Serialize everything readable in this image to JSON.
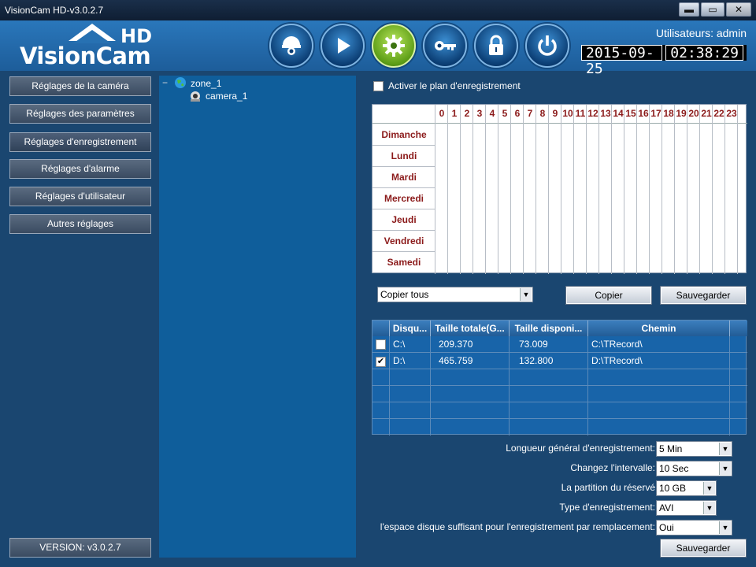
{
  "window": {
    "title": "VisionCam HD-v3.0.2.7",
    "min": "▬",
    "max": "▭",
    "close": "✕"
  },
  "logo": {
    "hd": "HD",
    "name": "VisionCam"
  },
  "toolbar": [
    {
      "icon": "camera-dome-icon"
    },
    {
      "icon": "play-icon"
    },
    {
      "icon": "gear-icon",
      "active": true
    },
    {
      "icon": "key-icon"
    },
    {
      "icon": "lock-icon"
    },
    {
      "icon": "power-icon"
    }
  ],
  "header": {
    "users": "Utilisateurs: admin",
    "date": "2015-09-25",
    "time": "02:38:29"
  },
  "sidebar": {
    "items": [
      {
        "label": "Réglages de la caméra"
      },
      {
        "label": "Réglages des paramètres"
      },
      {
        "label": "Réglages d'enregistrement",
        "active": true
      },
      {
        "label": "Réglages d'alarme"
      },
      {
        "label": "Réglages d'utilisateur"
      },
      {
        "label": "Autres réglages"
      }
    ],
    "version": "VERSION: v3.0.2.7"
  },
  "tree": {
    "toggle": "−",
    "zone": "zone_1",
    "camera": "camera_1"
  },
  "schedule": {
    "enable_label": "Activer le plan d'enregistrement",
    "enabled": false,
    "hours": [
      "0",
      "1",
      "2",
      "3",
      "4",
      "5",
      "6",
      "7",
      "8",
      "9",
      "10",
      "11",
      "12",
      "13",
      "14",
      "15",
      "16",
      "17",
      "18",
      "19",
      "20",
      "21",
      "22",
      "23"
    ],
    "days": [
      "Dimanche",
      "Lundi",
      "Mardi",
      "Mercredi",
      "Jeudi",
      "Vendredi",
      "Samedi"
    ]
  },
  "copy": {
    "select_value": "Copier tous",
    "copy_label": "Copier",
    "save_label": "Sauvegarder"
  },
  "disks": {
    "columns": [
      "Disqu...",
      "Taille totale(G...",
      "Taille disponi...",
      "Chemin"
    ],
    "rows": [
      {
        "checked": false,
        "disk": "C:\\",
        "total": "209.370",
        "avail": "73.009",
        "path": "C:\\TRecord\\"
      },
      {
        "checked": true,
        "disk": "D:\\",
        "total": "465.759",
        "avail": "132.800",
        "path": "D:\\TRecord\\"
      }
    ]
  },
  "settings": {
    "general_length": {
      "label": "Longueur général d'enregistrement:",
      "value": "5 Min"
    },
    "interval": {
      "label": "Changez l'intervalle:",
      "value": "10 Sec"
    },
    "reserved": {
      "label": "La partition du réservé",
      "value": "10 GB"
    },
    "type": {
      "label": "Type d'enregistrement:",
      "value": "AVI"
    },
    "overwrite": {
      "label": "l'espace disque suffisant pour l'enregistrement par remplacement:",
      "value": "Oui"
    },
    "save_label": "Sauvegarder"
  },
  "colors": {
    "background": "#1a4670",
    "header": "#2a77bb",
    "tree": "#0f5e9b",
    "day_text": "#8b1a1a"
  }
}
